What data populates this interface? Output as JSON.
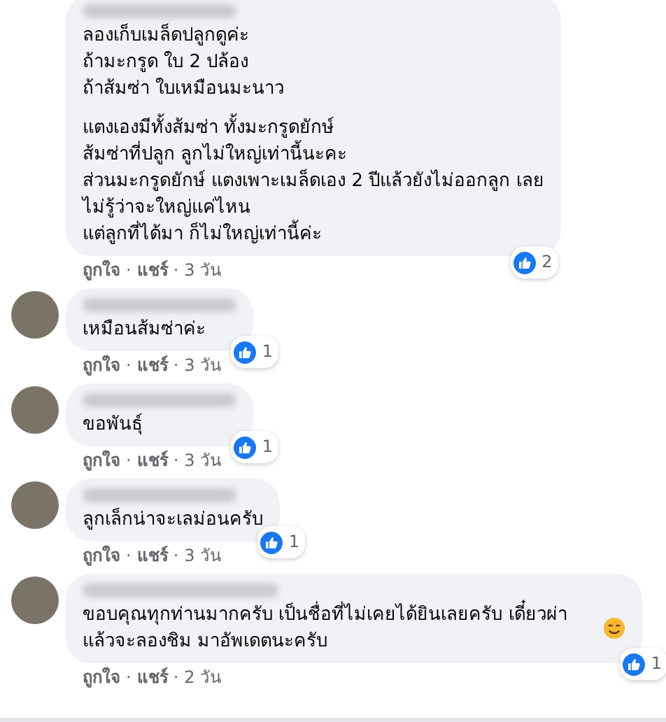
{
  "comments": [
    {
      "name_hidden": true,
      "paragraphs": [
        [
          "ลองเก็บเมล็ดปลูกดูค่ะ",
          "ถ้ามะกรูด ใบ 2 ปล้อง",
          "ถ้าส้มซ่า ใบเหมือนมะนาว"
        ],
        [
          "แตงเองมีทั้งส้มซ่า ทั้งมะกรูดยักษ์",
          "ส้มซ่าที่ปลูก ลูกไม่ใหญ่เท่านี้นะคะ",
          "ส่วนมะกรูดยักษ์ แตงเพาะเมล็ดเอง 2 ปีแล้วยังไม่ออกลูก เลย",
          "ไม่รู้ว่าจะใหญ่แค่ไหน",
          "แต่ลูกที่ได้มา ก็ไม่ใหญ่เท่านี้ค่ะ"
        ]
      ],
      "like": "ถูกใจ",
      "separator": "·",
      "share": "แชร์",
      "time": "3 วัน",
      "reactions": "2"
    },
    {
      "avatar": true,
      "name_hidden": true,
      "paragraphs": [
        [
          "เหมือนส้มซ่าค่ะ"
        ]
      ],
      "like": "ถูกใจ",
      "separator": "·",
      "share": "แชร์",
      "time": "3 วัน",
      "reactions": "1"
    },
    {
      "avatar": true,
      "name_hidden": true,
      "paragraphs": [
        [
          "ขอพันธุ์"
        ]
      ],
      "like": "ถูกใจ",
      "separator": "·",
      "share": "แชร์",
      "time": "3 วัน",
      "reactions": "1"
    },
    {
      "avatar": true,
      "name_hidden": true,
      "paragraphs": [
        [
          "ลูกเล็กน่าจะเลม่อนครับ"
        ]
      ],
      "like": "ถูกใจ",
      "separator": "·",
      "share": "แชร์",
      "time": "3 วัน",
      "reactions": "1"
    },
    {
      "avatar": true,
      "name_hidden": true,
      "paragraphs": [
        [
          "ขอบคุณทุกท่านมากครับ เป็นชื่อที่ไม่เคยได้ยินเลยครับ เดี๋ยวผ่าแล้วจะลองชิม มาอัพเดตนะครับ"
        ]
      ],
      "smiley": true,
      "like": "ถูกใจ",
      "separator": "·",
      "share": "แชร์",
      "time": "2 วัน",
      "reactions": "1"
    }
  ]
}
